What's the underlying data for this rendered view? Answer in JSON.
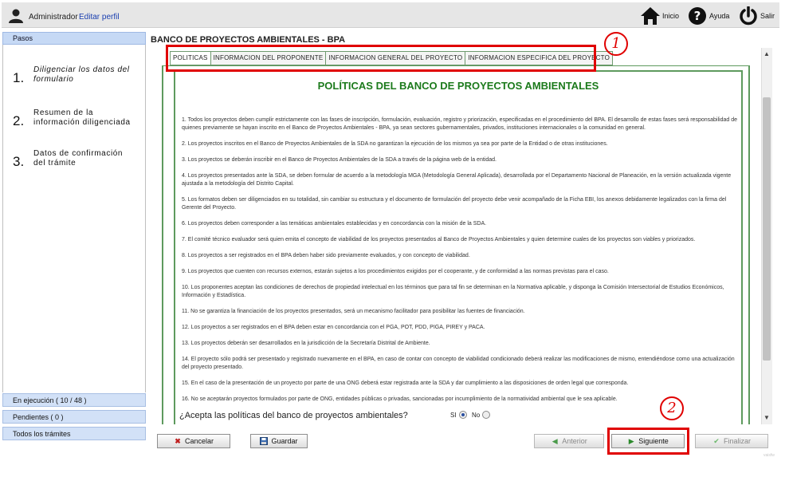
{
  "header": {
    "user": "Administrador",
    "edit_profile": "Editar perfil",
    "inicio": "Inicio",
    "ayuda": "Ayuda",
    "salir": "Salir"
  },
  "sidebar": {
    "title": "Pasos",
    "steps": [
      {
        "num": "1.",
        "label": "Diligenciar los datos del formulario"
      },
      {
        "num": "2.",
        "label": "Resumen de la información diligenciada"
      },
      {
        "num": "3.",
        "label": "Datos de confirmación del trámite"
      }
    ],
    "bottom": [
      "En ejecución ( 10 / 48 )",
      "Pendientes ( 0 )",
      "Todos los trámites"
    ]
  },
  "main": {
    "title": "BANCO DE PROYECTOS AMBIENTALES - BPA",
    "tabs": [
      "POLITICAS",
      "INFORMACION DEL PROPONENTE",
      "INFORMACION GENERAL DEL PROYECTO",
      "INFORMACION ESPECIFICA DEL PROYECTO"
    ],
    "policies_title": "POLÍTICAS DEL BANCO DE PROYECTOS AMBIENTALES",
    "policies": [
      "1. Todos los proyectos deben cumplir estrictamente con las fases de inscripción, formulación, evaluación, registro y priorización, especificadas en el procedimiento del BPA. El desarrollo de estas fases será responsabilidad de quienes previamente se hayan inscrito en el Banco de Proyectos Ambientales - BPA, ya sean sectores gubernamentales, privados, instituciones internacionales o la comunidad en general.",
      "2. Los proyectos inscritos en el Banco de Proyectos Ambientales de la SDA no garantizan la ejecución de los mismos ya sea por parte de la Entidad o de otras instituciones.",
      "3. Los proyectos se deberán inscribir en el Banco de Proyectos Ambientales de la SDA a través de la página web de la entidad.",
      "4. Los proyectos presentados ante la SDA, se deben formular de acuerdo a la metodología MGA (Metodología General Aplicada), desarrollada por el Departamento Nacional de Planeación, en la versión actualizada vigente ajustada a la metodología del Distrito Capital.",
      "5. Los formatos deben ser diligenciados en su totalidad, sin cambiar su estructura y el documento de formulación del proyecto debe venir acompañado de la Ficha EBI, los anexos debidamente legalizados con la firma del Gerente del Proyecto.",
      "6. Los proyectos deben corresponder a las temáticas ambientales establecidas y en concordancia con la misión de la SDA.",
      "7. El comité técnico evaluador será quien emita el concepto de viabilidad de los proyectos presentados al Banco de Proyectos Ambientales y quien determine cuales de los proyectos son viables y priorizados.",
      "8. Los proyectos a ser registrados en el BPA deben haber sido previamente evaluados, y con concepto de viabilidad.",
      "9. Los proyectos que cuenten con recursos externos, estarán sujetos a los procedimientos exigidos por el cooperante, y de conformidad a las normas previstas para el caso.",
      "10. Los proponentes aceptan las condiciones de derechos de propiedad intelectual en los términos que para tal fin se determinan en la Normativa aplicable, y disponga la Comisión Intersectorial de Estudios Económicos, Información y Estadística.",
      "11. No se garantiza la financiación de los proyectos presentados, será un mecanismo facilitador para posibilitar las fuentes de financiación.",
      "12. Los proyectos a ser registrados en el BPA deben estar en concordancia con el PGA, POT, PDD, PIGA, PIREY y PACA.",
      "13. Los proyectos deberán ser desarrollados en la jurisdicción de la Secretaría Distrital de Ambiente.",
      "14. El proyecto sólo podrá ser presentado y registrado nuevamente en el BPA, en caso de contar con concepto de viabilidad condicionado deberá realizar las modificaciones de mismo, entendiéndose como una actualización del proyecto presentado.",
      "15. En el caso de la presentación de un proyecto por parte de una ONG deberá estar registrada ante la SDA y dar cumplimiento a las disposiciones de orden legal que corresponda.",
      "16. No se aceptarán proyectos formulados por parte de ONG, entidades públicas o privadas, sancionadas por incumplimiento de la normatividad ambiental que le sea aplicable."
    ],
    "question": "¿Acepta las políticas del banco de proyectos ambientales?",
    "si": "SI",
    "no": "No"
  },
  "buttons": {
    "cancelar": "Cancelar",
    "guardar": "Guardar",
    "anterior": "Anterior",
    "siguiente": "Siguiente",
    "finalizar": "Finalizar"
  },
  "annotations": [
    "1",
    "2"
  ],
  "watermark": "vaisfw",
  "colors": {
    "accent_green": "#1c7a1c",
    "annotation_red": "#e00000",
    "sidebar_blue": "#c6d9f5"
  }
}
